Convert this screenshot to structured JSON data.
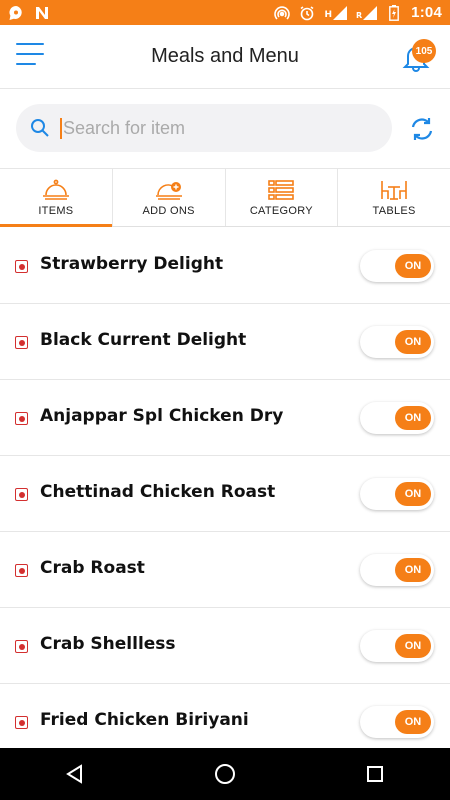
{
  "status_bar": {
    "time": "1:04",
    "left_icons": [
      "chat-icon",
      "n-icon"
    ],
    "right_icons": [
      "hotspot-icon",
      "alarm-icon",
      "signal-h-icon",
      "signal-r-icon",
      "battery-icon"
    ],
    "signal_h": "H",
    "signal_r": "R"
  },
  "header": {
    "title": "Meals and Menu",
    "notification_count": "105"
  },
  "search": {
    "placeholder": "Search for item",
    "value": ""
  },
  "tabs": [
    {
      "label": "ITEMS",
      "icon": "cloche-icon",
      "active": true
    },
    {
      "label": "ADD ONS",
      "icon": "cloche-plus-icon",
      "active": false
    },
    {
      "label": "CATEGORY",
      "icon": "list-icon",
      "active": false
    },
    {
      "label": "TABLES",
      "icon": "table-chairs-icon",
      "active": false
    }
  ],
  "items": [
    {
      "name": "Strawberry Delight",
      "toggle": "ON"
    },
    {
      "name": "Black Current Delight",
      "toggle": "ON"
    },
    {
      "name": "Anjappar Spl Chicken Dry",
      "toggle": "ON"
    },
    {
      "name": "Chettinad Chicken Roast",
      "toggle": "ON"
    },
    {
      "name": "Crab Roast",
      "toggle": "ON"
    },
    {
      "name": "Crab Shellless",
      "toggle": "ON"
    },
    {
      "name": "Fried Chicken Biriyani",
      "toggle": "ON"
    }
  ],
  "colors": {
    "accent": "#f57f17",
    "icon_blue": "#1e88e5",
    "non_veg_marker": "#d32f2f"
  },
  "nav_bar": [
    "back-icon",
    "home-icon",
    "recents-icon"
  ]
}
